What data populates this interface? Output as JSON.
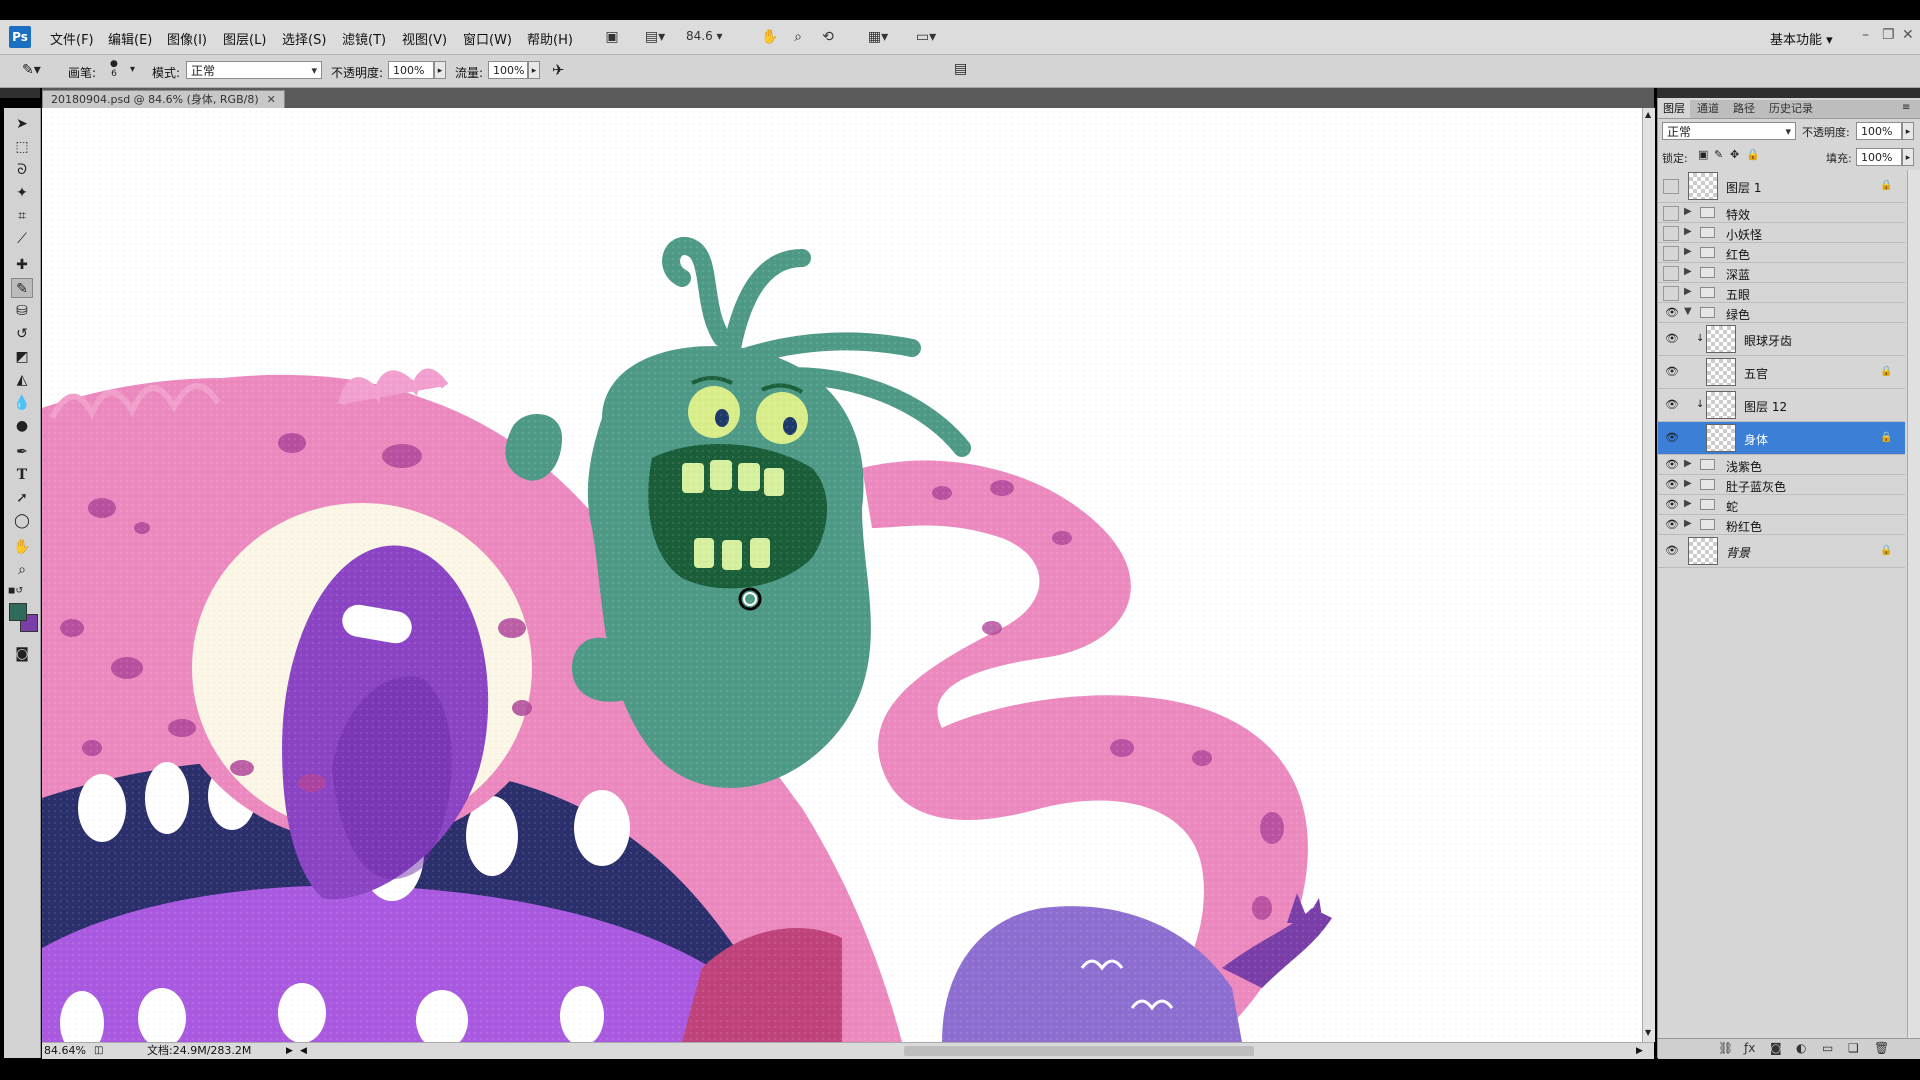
{
  "app": {
    "logo": "Ps"
  },
  "menubar": {
    "items": [
      "文件(F)",
      "编辑(E)",
      "图像(I)",
      "图层(L)",
      "选择(S)",
      "滤镜(T)",
      "视图(V)",
      "窗口(W)",
      "帮助(H)"
    ],
    "zoom": "84.6",
    "workspace": "基本功能",
    "icons": [
      "bridge-icon",
      "view-extras-icon",
      "hand-icon",
      "zoom-icon",
      "rotate-view-icon",
      "arrange-icon",
      "screen-mode-icon"
    ]
  },
  "options": {
    "brush_label": "画笔:",
    "brush_size": "6",
    "mode_label": "模式:",
    "mode_value": "正常",
    "opacity_label": "不透明度:",
    "opacity_value": "100%",
    "flow_label": "流量:",
    "flow_value": "100%"
  },
  "document": {
    "tab_title": "20180904.psd @ 84.6% (身体, RGB/8)",
    "zoom_status": "84.64%",
    "doc_size": "文档:24.9M/283.2M"
  },
  "panel": {
    "tabs": [
      "图层",
      "通道",
      "路径",
      "历史记录"
    ],
    "blend_mode": "正常",
    "opacity_label": "不透明度:",
    "opacity_value": "100%",
    "lock_label": "锁定:",
    "fill_label": "填充:",
    "fill_value": "100%",
    "layers": [
      {
        "name": "图层 1",
        "type": "layer",
        "visible": false,
        "locked": true
      },
      {
        "name": "特效",
        "type": "group",
        "visible": false
      },
      {
        "name": "小妖怪",
        "type": "group",
        "visible": false
      },
      {
        "name": "红色",
        "type": "group",
        "visible": false
      },
      {
        "name": "深蓝",
        "type": "group",
        "visible": false
      },
      {
        "name": "五眼",
        "type": "group",
        "visible": false
      },
      {
        "name": "绿色",
        "type": "group",
        "visible": true,
        "expanded": true
      },
      {
        "name": "眼球牙齿",
        "type": "layer",
        "visible": true,
        "clipped": true
      },
      {
        "name": "五官",
        "type": "layer",
        "visible": true,
        "locked": true
      },
      {
        "name": "图层 12",
        "type": "layer",
        "visible": true,
        "clipped": true
      },
      {
        "name": "身体",
        "type": "layer",
        "visible": true,
        "locked": true,
        "selected": true
      },
      {
        "name": "浅紫色",
        "type": "group",
        "visible": true
      },
      {
        "name": "肚子蓝灰色",
        "type": "group",
        "visible": true
      },
      {
        "name": "蛇",
        "type": "group",
        "visible": true
      },
      {
        "name": "粉红色",
        "type": "group",
        "visible": true
      },
      {
        "name": "背景",
        "type": "layer",
        "visible": true,
        "locked": true,
        "italic": true
      }
    ]
  },
  "colors": {
    "foreground": "#2e6b5c",
    "background": "#7a3ea8",
    "selection": "#3b7fd6"
  }
}
